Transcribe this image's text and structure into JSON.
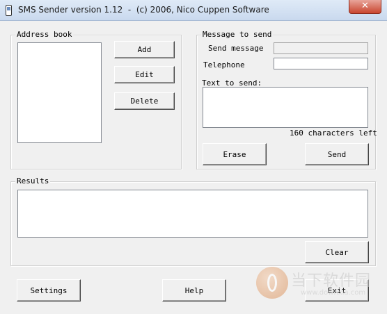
{
  "window": {
    "title": "SMS Sender version 1.12  -  (c) 2006, Nico Cuppen Software",
    "close_glyph": "✕"
  },
  "address_book": {
    "legend": "Address book",
    "add_label": "Add",
    "edit_label": "Edit",
    "delete_label": "Delete"
  },
  "message": {
    "legend": "Message to send",
    "send_message_label": "Send message",
    "send_message_value": "",
    "telephone_label": "Telephone",
    "telephone_value": "",
    "text_label": "Text to send:",
    "text_value": "",
    "chars_left": "160 characters left",
    "erase_label": "Erase",
    "send_label": "Send"
  },
  "results": {
    "legend": "Results",
    "value": "",
    "clear_label": "Clear"
  },
  "footer": {
    "settings_label": "Settings",
    "help_label": "Help",
    "exit_label": "Exit"
  },
  "watermark": {
    "text": "当下软件园",
    "url": "www.downxia.com"
  }
}
